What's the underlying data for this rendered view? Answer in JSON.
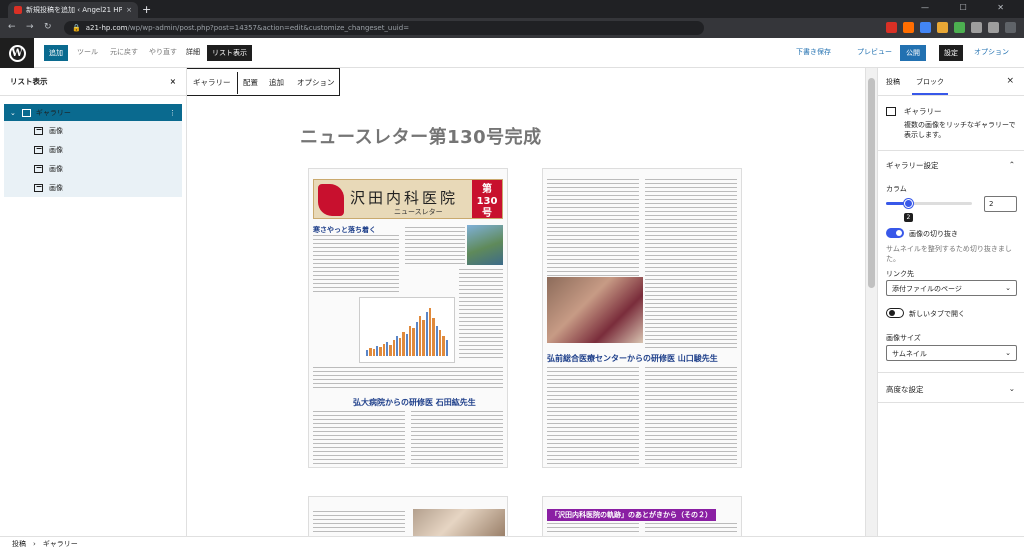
{
  "browser": {
    "tab_title": "新規投稿を追加 ‹ Angel21 HP Bl...",
    "tab_close": "×",
    "new_tab": "+",
    "window_controls": "— ☐ ✕",
    "url_host": "a21-hp.com",
    "url_rest": "/wp/wp-admin/post.php?post=14357&action=edit&customize_changeset_uuid=",
    "nav_back": "←",
    "nav_forward": "→",
    "nav_reload": "↻",
    "extension_colors": [
      "#d93025",
      "#ff6d00",
      "#4285f4",
      "#e8a735",
      "#4caf50",
      "#9e9e9e",
      "#9e9e9e",
      "#5f6368"
    ]
  },
  "toolbar": {
    "add": "追加",
    "tools": "ツール",
    "undo": "元に戻す",
    "redo": "やり直す",
    "details": "詳細",
    "list_view": "リスト表示",
    "save_draft": "下書き保存",
    "preview": "プレビュー",
    "publish": "公開",
    "settings": "設定",
    "options": "オプション"
  },
  "list_panel": {
    "title": "リスト表示",
    "close": "×",
    "gallery_label": "ギャラリー",
    "gallery_more": "⋮",
    "images": [
      "画像",
      "画像",
      "画像",
      "画像"
    ]
  },
  "block_toolbar": {
    "gallery": "ギャラリー",
    "align": "配置",
    "add": "追加",
    "options": "オプション"
  },
  "canvas": {
    "heading": "ニュースレター第130号完成",
    "page1_banner_name": "沢田内科医院",
    "page1_banner_sub": "ニュースレター",
    "page1_banner_num": "第130号",
    "page1_head1": "寒さやっと落ち着く",
    "page1_section2": "弘大病院からの研修医 石田紘先生",
    "page2_section": "弘前総合医療センターからの研修医 山口駿先生",
    "page4_banner": "「沢田内科医院の軌跡」のあとがきから（その２）"
  },
  "right_panel": {
    "tab_post": "投稿",
    "tab_block": "ブロック",
    "close": "×",
    "block_name": "ギャラリー",
    "block_desc": "複数の画像をリッチなギャラリーで表示します。",
    "settings_title": "ギャラリー設定",
    "columns_label": "カラム",
    "columns_value": "2",
    "columns_tooltip": "2",
    "columns_fraction": 0.25,
    "crop_label": "画像の切り抜き",
    "crop_on": true,
    "crop_help": "サムネイルを整列するため切り抜きました。",
    "link_label": "リンク先",
    "link_value": "添付ファイルのページ",
    "new_tab_label": "新しいタブで開く",
    "new_tab_on": false,
    "size_label": "画像サイズ",
    "size_value": "サムネイル",
    "advanced": "高度な設定"
  },
  "footer": {
    "crumb1": "投稿",
    "separator": "›",
    "crumb2": "ギャラリー"
  }
}
